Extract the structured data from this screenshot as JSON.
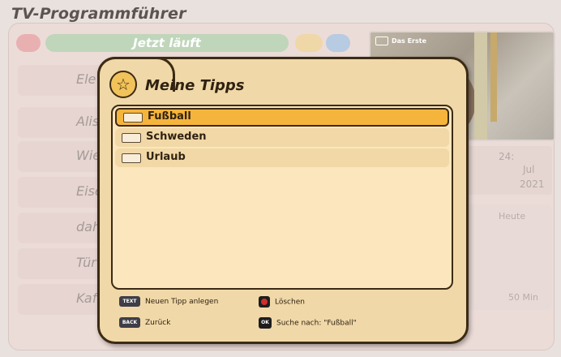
{
  "app": {
    "title": "TV-Programmführer"
  },
  "background": {
    "now_tab": "Jetzt läuft",
    "preview_channel": "Das Erste",
    "rows": [
      "Ele",
      "Alis",
      "Wie",
      "Eise",
      "dah",
      "Tür",
      "Kaf"
    ],
    "info_values": [
      "24:",
      "Jul",
      "2021"
    ],
    "side_labels": [
      "Heute",
      "50 Min"
    ]
  },
  "dialog": {
    "title": "Meine Tipps",
    "tips": [
      {
        "label": "Fußball",
        "selected": true
      },
      {
        "label": "Schweden",
        "selected": false
      },
      {
        "label": "Urlaub",
        "selected": false
      }
    ],
    "legend": {
      "new_tip": {
        "key": "TEXT",
        "label": "Neuen Tipp anlegen"
      },
      "delete": {
        "key": "red",
        "label": "Löschen"
      },
      "back": {
        "key": "BACK",
        "label": "Zurück"
      },
      "search": {
        "key": "OK",
        "label": "Suche nach: \"Fußball\""
      }
    }
  },
  "colors": {
    "popup_bg": "#f0d8a8",
    "selection": "#f5b43c",
    "border": "#3c2b14"
  }
}
